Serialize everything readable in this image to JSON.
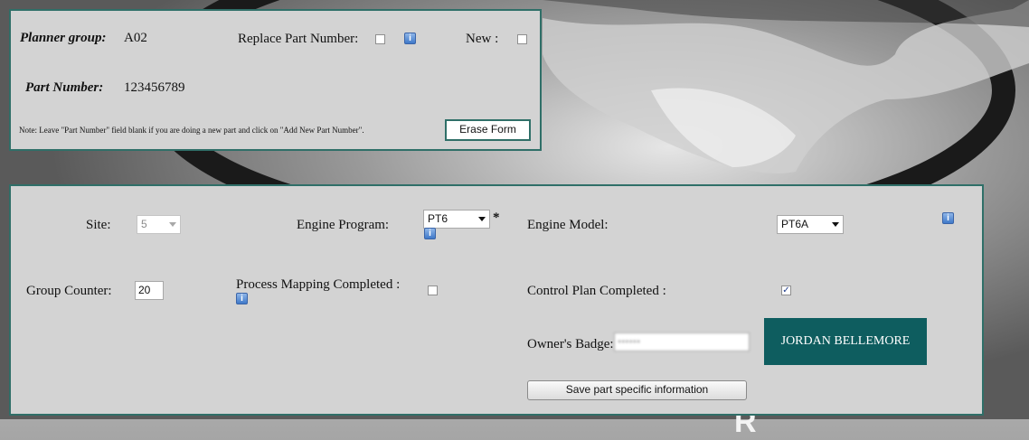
{
  "top_form": {
    "planner_group_label": "Planner group:",
    "planner_group_value": "A02",
    "replace_part_label": "Replace Part Number:",
    "replace_part_checked": false,
    "new_label": "New :",
    "new_checked": false,
    "part_number_label": "Part Number:",
    "part_number_value": "123456789",
    "note": "Note: Leave \"Part Number\" field blank if you are doing a new part and click on \"Add New Part Number\".",
    "erase_button": "Erase Form"
  },
  "main_form": {
    "site_label": "Site:",
    "site_value": "5",
    "engine_program_label": "Engine Program:",
    "engine_program_value": "PT6",
    "required_mark": "*",
    "engine_model_label": "Engine Model:",
    "engine_model_value": "PT6A",
    "group_counter_label": "Group Counter:",
    "group_counter_value": "20",
    "process_mapping_label": "Process Mapping Completed :",
    "process_mapping_checked": false,
    "control_plan_label": "Control Plan Completed :",
    "control_plan_checked": true,
    "owner_badge_label": "Owner's Badge:",
    "owner_name_button": "JORDAN BELLEMORE",
    "save_button": "Save part specific information"
  },
  "icons": {
    "info": "info-icon",
    "check": "✓",
    "info_glyph": "i"
  }
}
